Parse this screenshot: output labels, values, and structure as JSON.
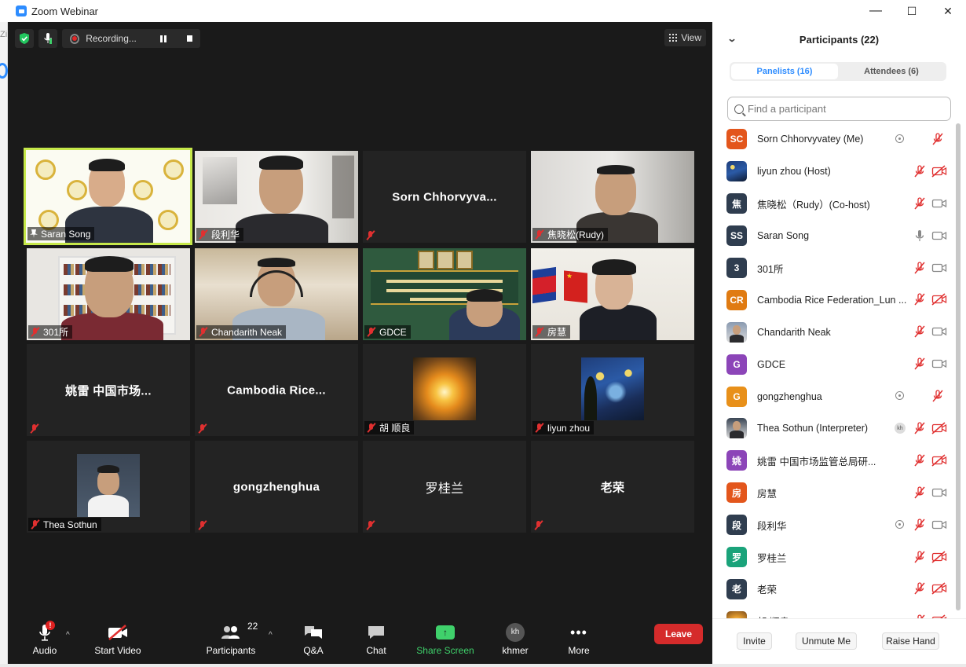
{
  "window": {
    "title": "Zoom Webinar",
    "minimize": "—",
    "maximize": "☐",
    "close": "✕"
  },
  "left_fragment": "Zi",
  "topbar": {
    "recording_label": "Recording...",
    "view_label": "View"
  },
  "tiles": [
    {
      "name": "Saran Song",
      "kind": "video-yellow",
      "active": true,
      "pinned": true
    },
    {
      "name": "段利华",
      "kind": "video-office"
    },
    {
      "name": "Sorn  Chhorvyva...",
      "kind": "name-only"
    },
    {
      "name": "焦晓松(Rudy)",
      "kind": "video-office2"
    },
    {
      "name": "301所",
      "kind": "video-books"
    },
    {
      "name": "Chandarith Neak",
      "kind": "video-room"
    },
    {
      "name": "GDCE",
      "kind": "video-customs"
    },
    {
      "name": "房慧",
      "kind": "video-flags"
    },
    {
      "name": "姚雷 中国市场...",
      "kind": "name-only"
    },
    {
      "name": "Cambodia  Rice...",
      "kind": "name-only"
    },
    {
      "name": "胡 顺良",
      "kind": "thumb-sunset"
    },
    {
      "name": "liyun zhou",
      "kind": "thumb-starry"
    },
    {
      "name": "Thea Sothun",
      "kind": "thumb-thea"
    },
    {
      "name": "gongzhenghua",
      "kind": "name-only"
    },
    {
      "name": "罗桂兰",
      "kind": "name-only-plain"
    },
    {
      "name": "老荣",
      "kind": "name-only"
    }
  ],
  "toolbar": {
    "audio": "Audio",
    "audio_badge": "!",
    "start_video": "Start Video",
    "participants": "Participants",
    "participants_count": "22",
    "qa": "Q&A",
    "chat": "Chat",
    "share_screen": "Share Screen",
    "khmer": "khmer",
    "khmer_badge": "kh",
    "more": "More",
    "leave": "Leave"
  },
  "panel": {
    "title": "Participants (22)",
    "tab_panelists": "Panelists (16)",
    "tab_attendees": "Attendees (6)",
    "search_placeholder": "Find a participant",
    "participants": [
      {
        "initials": "SC",
        "name": "Sorn Chhorvyvatey (Me)",
        "color": "#e3561c",
        "mic": "muted",
        "cam": "none",
        "extra": "rec"
      },
      {
        "initials": "",
        "name": "liyun zhou (Host)",
        "color": "#2b4f8a",
        "avatar": "starry",
        "mic": "muted",
        "cam": "off"
      },
      {
        "initials": "焦",
        "name": "焦晓松（Rudy）(Co-host)",
        "color": "#2f3d4f",
        "mic": "muted",
        "cam": "on"
      },
      {
        "initials": "SS",
        "name": "Saran Song",
        "color": "#2f3d4f",
        "mic": "on",
        "cam": "on"
      },
      {
        "initials": "3",
        "name": "301所",
        "color": "#2f3d4f",
        "mic": "muted",
        "cam": "on"
      },
      {
        "initials": "CR",
        "name": "Cambodia Rice Federation_Lun ...",
        "color": "#e07b12",
        "mic": "muted",
        "cam": "off"
      },
      {
        "initials": "",
        "name": "Chandarith Neak",
        "color": "#8a9ab0",
        "avatar": "photo",
        "mic": "muted",
        "cam": "on"
      },
      {
        "initials": "G",
        "name": "GDCE",
        "color": "#8c45b8",
        "mic": "muted",
        "cam": "on"
      },
      {
        "initials": "G",
        "name": "gongzhenghua",
        "color": "#e8901a",
        "mic": "muted",
        "cam": "none",
        "extra": "rec"
      },
      {
        "initials": "",
        "name": "Thea Sothun (Interpreter)",
        "color": "#3a4554",
        "avatar": "photo",
        "mic": "muted",
        "cam": "off",
        "extra": "kh",
        "extra_text": "kh"
      },
      {
        "initials": "姚",
        "name": "姚雷 中国市场监管总局研...",
        "color": "#8c45b8",
        "mic": "muted",
        "cam": "off"
      },
      {
        "initials": "房",
        "name": "房慧",
        "color": "#e3561c",
        "mic": "muted",
        "cam": "on"
      },
      {
        "initials": "段",
        "name": "段利华",
        "color": "#2f3d4f",
        "mic": "muted",
        "cam": "on",
        "extra": "rec"
      },
      {
        "initials": "罗",
        "name": "罗桂兰",
        "color": "#1aa37a",
        "mic": "muted",
        "cam": "off"
      },
      {
        "initials": "老",
        "name": "老荣",
        "color": "#2f3d4f",
        "mic": "muted",
        "cam": "off"
      },
      {
        "initials": "",
        "name": "胡 顺良",
        "color": "#e0b050",
        "avatar": "sunset",
        "mic": "muted",
        "cam": "off"
      }
    ],
    "footer": {
      "invite": "Invite",
      "unmute_me": "Unmute Me",
      "raise_hand": "Raise Hand"
    }
  },
  "colors": {
    "accent": "#2d8cff",
    "leave": "#d52b2b",
    "share": "#3fd16b",
    "active_speaker": "#c6e84a",
    "muted_red": "#e03030"
  }
}
